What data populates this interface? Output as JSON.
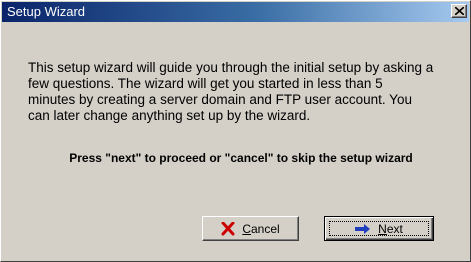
{
  "window": {
    "title": "Setup Wizard",
    "close_glyph": "x"
  },
  "content": {
    "intro_lines": [
      "This setup wizard will guide you through the initial setup by asking a",
      "few questions. The wizard will get you started in less than 5",
      "minutes by creating a server domain and FTP user account. You",
      "can later change anything set up by the wizard."
    ],
    "prompt": "Press \"next\" to proceed or \"cancel\" to skip the setup wizard"
  },
  "buttons": {
    "cancel": {
      "accel": "C",
      "rest": "ancel",
      "icon": "red-x-icon"
    },
    "next": {
      "accel": "N",
      "rest": "ext",
      "icon": "blue-arrow-right-icon"
    }
  },
  "colors": {
    "titlebar_start": "#0a246a",
    "titlebar_end": "#a6caf0",
    "cancel_icon": "#cc0000",
    "next_icon": "#1f3fbf"
  }
}
